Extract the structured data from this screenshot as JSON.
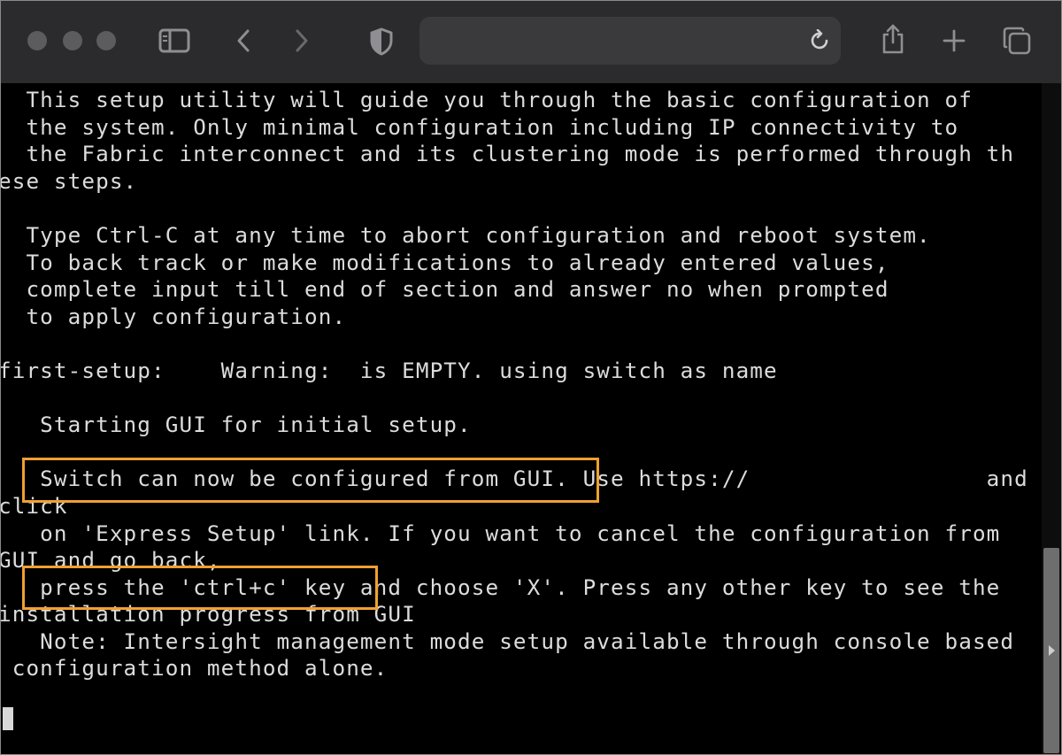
{
  "browser": {
    "address_bar": {
      "url": ""
    },
    "icons": {
      "sidebar": "sidebar-icon",
      "back": "chevron-left-icon",
      "forward": "chevron-right-icon",
      "privacy": "shield-icon",
      "reload": "reload-icon",
      "share": "share-icon",
      "new_tab": "plus-icon",
      "tabs": "tabs-overview-icon"
    }
  },
  "terminal": {
    "lines": [
      "  This setup utility will guide you through the basic configuration of",
      "  the system. Only minimal configuration including IP connectivity to",
      "  the Fabric interconnect and its clustering mode is performed through th",
      "ese steps.",
      "",
      "  Type Ctrl-C at any time to abort configuration and reboot system.",
      "  To back track or make modifications to already entered values,",
      "  complete input till end of section and answer no when prompted",
      "  to apply configuration.",
      "",
      "first-setup:    Warning:  is EMPTY. using switch as name",
      "",
      "   Starting GUI for initial setup.",
      "",
      "   Switch can now be configured from GUI. Use https://                 and",
      "click",
      "   on 'Express Setup' link. If you want to cancel the configuration from",
      "GUI and go back,",
      "   press the 'ctrl+c' key and choose 'X'. Press any other key to see the",
      "installation progress from GUI",
      "   Note: Intersight management mode setup available through console based",
      " configuration method alone."
    ]
  },
  "colors": {
    "highlight": "#f0a030",
    "terminal_bg": "#000000",
    "terminal_fg": "#dcdcdc",
    "toolbar_bg": "#2b2b2d"
  }
}
